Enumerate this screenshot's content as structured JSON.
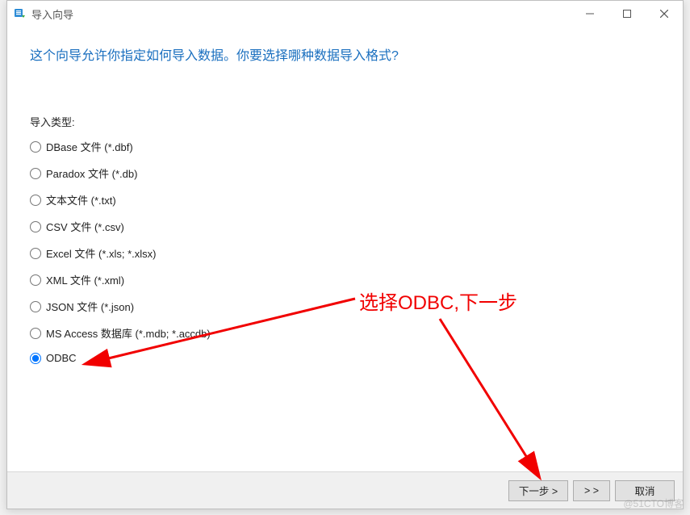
{
  "window": {
    "title": "导入向导"
  },
  "heading": "这个向导允许你指定如何导入数据。你要选择哪种数据导入格式?",
  "section_label": "导入类型:",
  "options": [
    {
      "label": "DBase 文件 (*.dbf)",
      "selected": false
    },
    {
      "label": "Paradox 文件 (*.db)",
      "selected": false
    },
    {
      "label": "文本文件 (*.txt)",
      "selected": false
    },
    {
      "label": "CSV 文件 (*.csv)",
      "selected": false
    },
    {
      "label": "Excel 文件 (*.xls; *.xlsx)",
      "selected": false
    },
    {
      "label": "XML 文件 (*.xml)",
      "selected": false
    },
    {
      "label": "JSON 文件 (*.json)",
      "selected": false
    },
    {
      "label": "MS Access 数据库 (*.mdb; *.accdb)",
      "selected": false
    },
    {
      "label": "ODBC",
      "selected": true
    }
  ],
  "buttons": {
    "next": "下一步 >",
    "skip": "> >",
    "cancel": "取消"
  },
  "annotation": {
    "text": "选择ODBC,下一步"
  },
  "watermark": "@51CTO博客"
}
